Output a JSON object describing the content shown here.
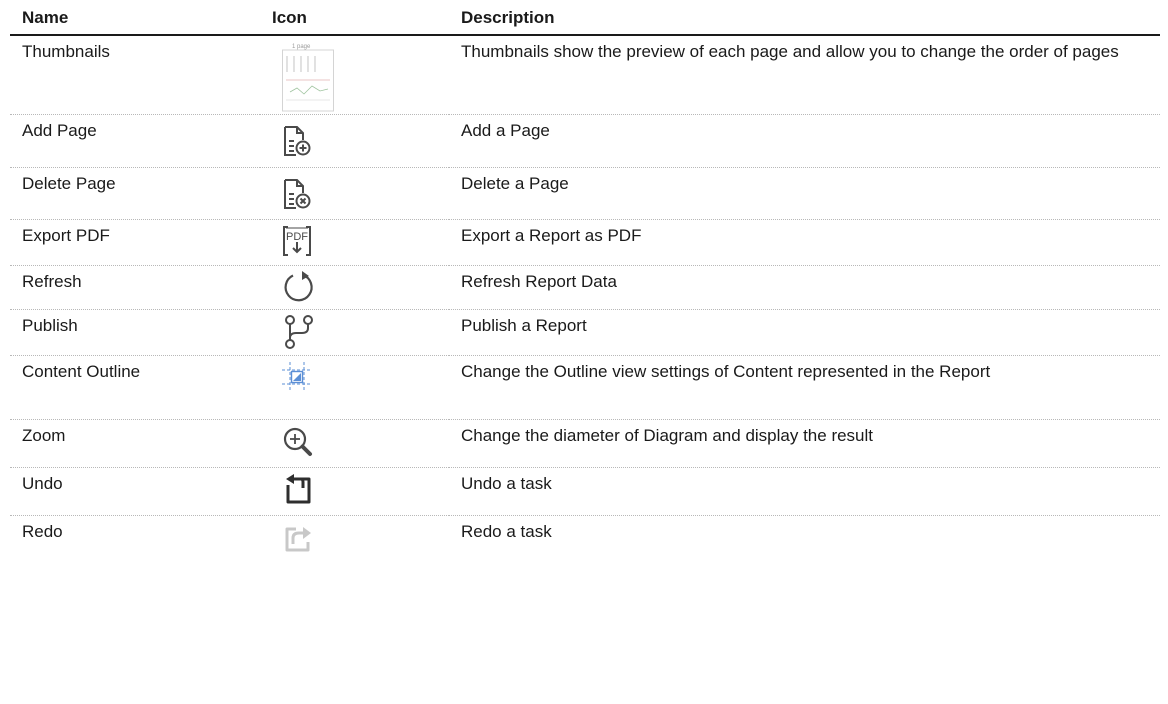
{
  "header": {
    "name": "Name",
    "icon": "Icon",
    "description": "Description"
  },
  "rows": [
    {
      "name": "Thumbnails",
      "icon": "page-thumbnail-icon",
      "thumb_label": "1 page",
      "description": "Thumbnails show the preview of each page and allow you to change the order of pages"
    },
    {
      "name": "Add Page",
      "icon": "add-page-icon",
      "description": "Add a Page"
    },
    {
      "name": "Delete Page",
      "icon": "delete-page-icon",
      "description": "Delete a Page"
    },
    {
      "name": "Export PDF",
      "icon": "export-pdf-icon",
      "pdf_label": "PDF",
      "description": "Export a Report as PDF"
    },
    {
      "name": "Refresh",
      "icon": "refresh-icon",
      "description": "Refresh Report Data"
    },
    {
      "name": "Publish",
      "icon": "publish-icon",
      "description": "Publish a Report"
    },
    {
      "name": "Content Outline",
      "icon": "content-outline-icon",
      "description": "Change the Outline view settings of Content represented in the Report"
    },
    {
      "name": "Zoom",
      "icon": "zoom-in-icon",
      "description": "Change the diameter of Diagram and display the result"
    },
    {
      "name": "Undo",
      "icon": "undo-icon",
      "description": "Undo a task"
    },
    {
      "name": "Redo",
      "icon": "redo-icon",
      "description": "Redo a task"
    }
  ],
  "colors": {
    "text": "#1a1a1a",
    "icon_dark": "#4a4a4a",
    "outline_blue": "#5b8fd6",
    "redo_gray": "#c8c8c8"
  }
}
